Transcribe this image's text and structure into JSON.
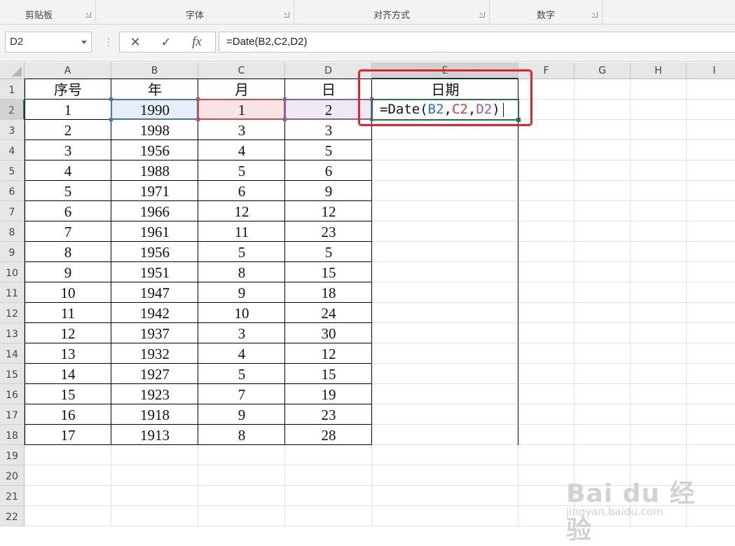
{
  "ribbon": {
    "groups": [
      {
        "label": "剪贴板"
      },
      {
        "label": "字体"
      },
      {
        "label": "对齐方式"
      },
      {
        "label": "数字"
      }
    ]
  },
  "formula_bar": {
    "name_box": "D2",
    "cancel_glyph": "✕",
    "enter_glyph": "✓",
    "fx_glyph": "fx",
    "formula": "=Date(B2,C2,D2)"
  },
  "sheet": {
    "columns": [
      "A",
      "B",
      "C",
      "D",
      "E",
      "F",
      "G",
      "H",
      "I"
    ],
    "rows": [
      "1",
      "2",
      "3",
      "4",
      "5",
      "6",
      "7",
      "8",
      "9",
      "10",
      "11",
      "12",
      "13",
      "14",
      "15",
      "16",
      "17",
      "18",
      "19",
      "20",
      "21",
      "22"
    ],
    "headers": [
      "序号",
      "年",
      "月",
      "日",
      "日期"
    ],
    "data": [
      [
        "1",
        "1990",
        "1",
        "2"
      ],
      [
        "2",
        "1998",
        "3",
        "3"
      ],
      [
        "3",
        "1956",
        "4",
        "5"
      ],
      [
        "4",
        "1988",
        "5",
        "6"
      ],
      [
        "5",
        "1971",
        "6",
        "9"
      ],
      [
        "6",
        "1966",
        "12",
        "12"
      ],
      [
        "7",
        "1961",
        "11",
        "23"
      ],
      [
        "8",
        "1956",
        "5",
        "5"
      ],
      [
        "9",
        "1951",
        "8",
        "15"
      ],
      [
        "10",
        "1947",
        "9",
        "18"
      ],
      [
        "11",
        "1942",
        "10",
        "24"
      ],
      [
        "12",
        "1937",
        "3",
        "30"
      ],
      [
        "13",
        "1932",
        "4",
        "12"
      ],
      [
        "14",
        "1927",
        "5",
        "15"
      ],
      [
        "15",
        "1923",
        "7",
        "19"
      ],
      [
        "16",
        "1918",
        "9",
        "23"
      ],
      [
        "17",
        "1913",
        "8",
        "28"
      ]
    ],
    "editing_cell": {
      "ref": "E2",
      "parts": [
        {
          "text": "=Date(",
          "color": "#111111"
        },
        {
          "text": "B2",
          "color": "#2e6cc4"
        },
        {
          "text": ",",
          "color": "#111111"
        },
        {
          "text": "C2",
          "color": "#d63a3a"
        },
        {
          "text": ",",
          "color": "#111111"
        },
        {
          "text": "D2",
          "color": "#8a5cc0"
        },
        {
          "text": ")",
          "color": "#111111"
        }
      ]
    },
    "ref_colors": {
      "B": "#4472c4",
      "C": "#c0504d",
      "D": "#8064a2"
    },
    "ref_fills": {
      "B": "#e7eef9",
      "C": "#f7e4e4",
      "D": "#efe9f6"
    }
  },
  "colors": {
    "accent": "#217346",
    "highlight": "#e8212b"
  },
  "watermark": {
    "text": "Bai du 经验",
    "url": "jingyan.baidu.com"
  }
}
